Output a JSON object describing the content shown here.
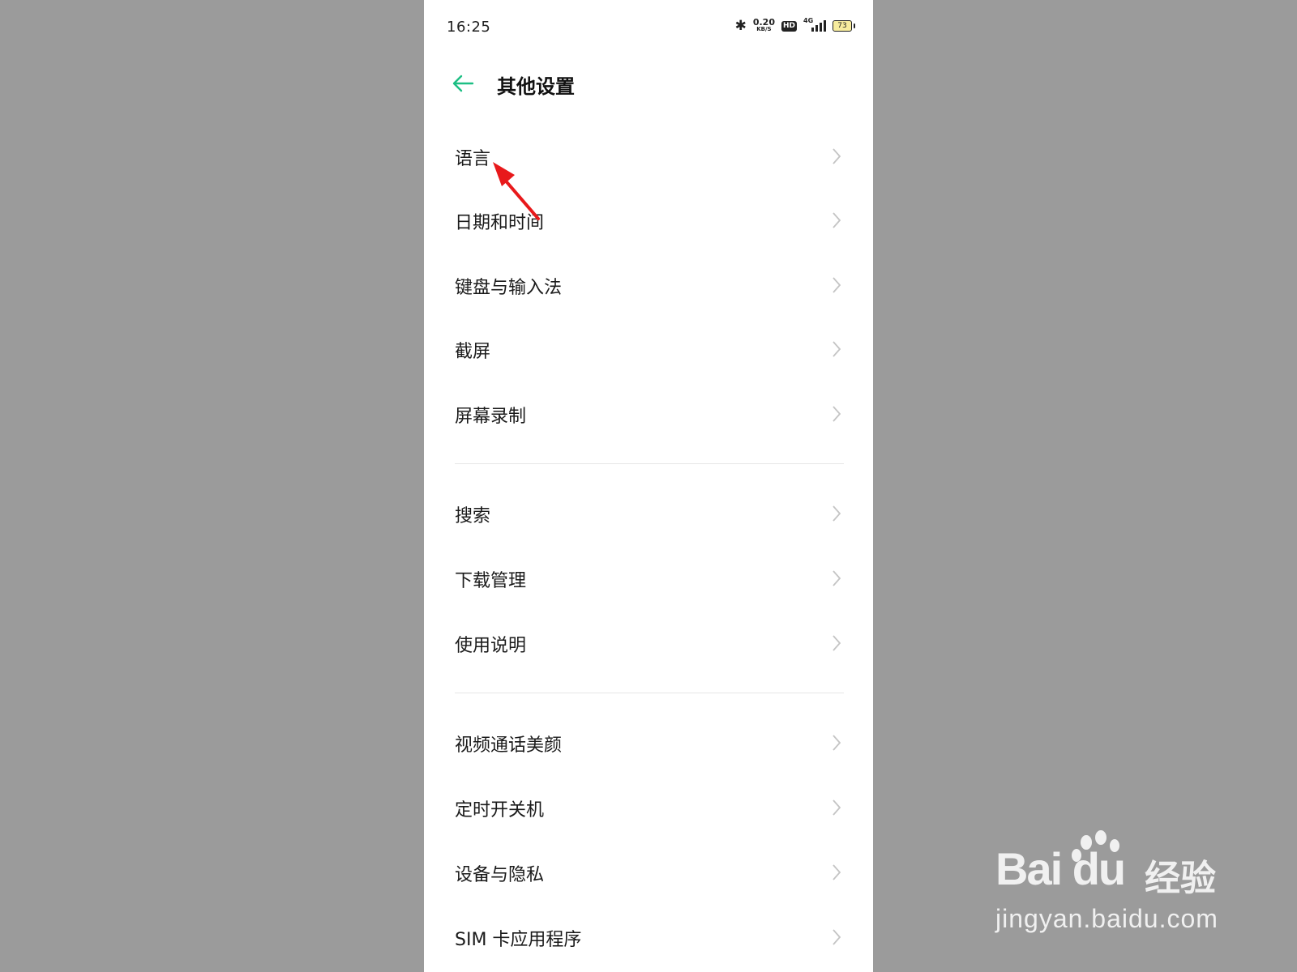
{
  "status_bar": {
    "time": "16:25",
    "net_speed_value": "0.20",
    "net_speed_unit": "KB/S",
    "hd_label": "HD",
    "network_type": "4G",
    "battery_level": "73"
  },
  "header": {
    "title": "其他设置"
  },
  "groups": [
    {
      "items": [
        {
          "label": "语言"
        },
        {
          "label": "日期和时间"
        },
        {
          "label": "键盘与输入法"
        },
        {
          "label": "截屏"
        },
        {
          "label": "屏幕录制"
        }
      ]
    },
    {
      "items": [
        {
          "label": "搜索"
        },
        {
          "label": "下载管理"
        },
        {
          "label": "使用说明"
        }
      ]
    },
    {
      "items": [
        {
          "label": "视频通话美颜"
        },
        {
          "label": "定时开关机"
        },
        {
          "label": "设备与隐私"
        },
        {
          "label": "SIM 卡应用程序"
        }
      ]
    }
  ],
  "colors": {
    "accent": "#1dbf84",
    "annotation": "#e8191b"
  },
  "watermark": {
    "brand": "Bai du",
    "jingyan": "经验",
    "url": "jingyan.baidu.com"
  }
}
